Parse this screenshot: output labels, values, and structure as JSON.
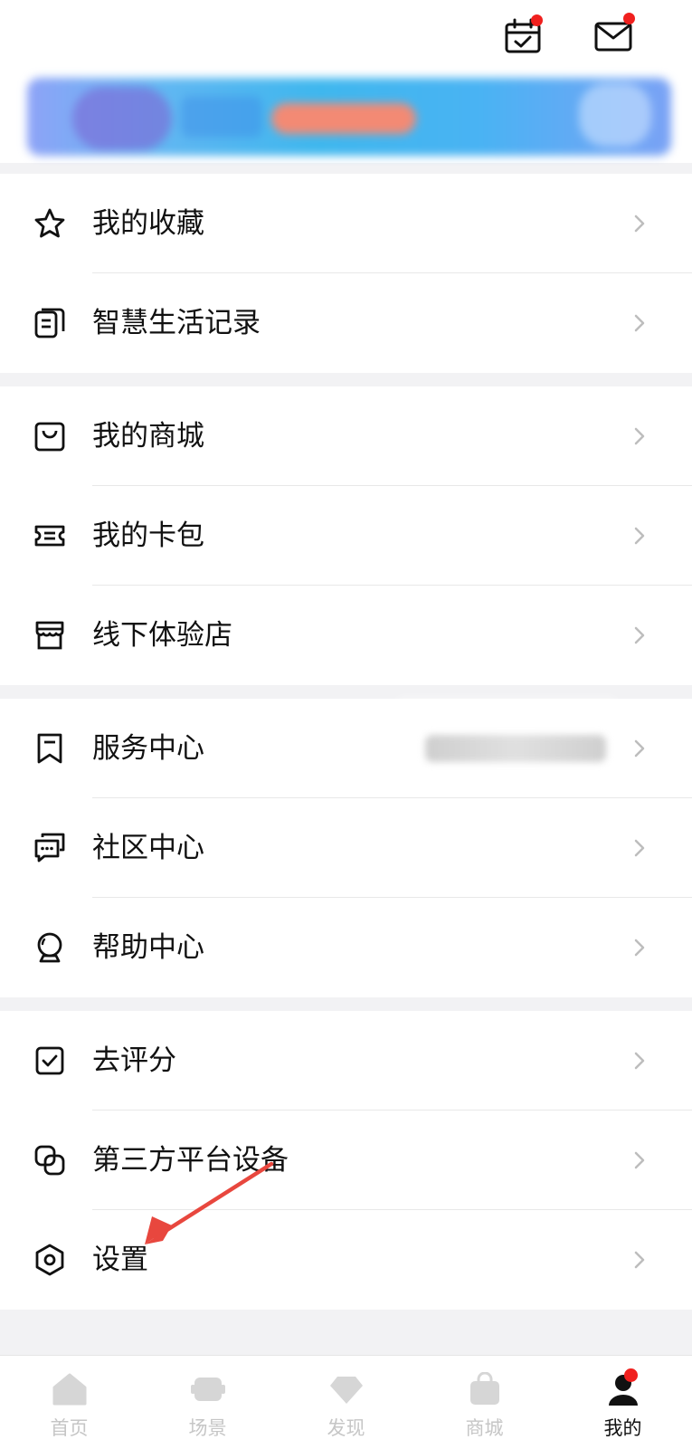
{
  "menu": {
    "group1": [
      {
        "label": "我的收藏",
        "icon": "star-icon"
      },
      {
        "label": "智慧生活记录",
        "icon": "document-icon"
      }
    ],
    "group2": [
      {
        "label": "我的商城",
        "icon": "shopping-bag-icon"
      },
      {
        "label": "我的卡包",
        "icon": "ticket-icon"
      },
      {
        "label": "线下体验店",
        "icon": "store-icon"
      }
    ],
    "group3": [
      {
        "label": "服务中心",
        "icon": "bookmark-icon"
      },
      {
        "label": "社区中心",
        "icon": "chat-bubbles-icon"
      },
      {
        "label": "帮助中心",
        "icon": "help-bulb-icon"
      }
    ],
    "group4": [
      {
        "label": "去评分",
        "icon": "checkbox-icon"
      },
      {
        "label": "第三方平台设备",
        "icon": "link-devices-icon"
      },
      {
        "label": "设置",
        "icon": "gear-hexagon-icon"
      }
    ]
  },
  "tabbar": [
    {
      "label": "首页",
      "icon": "home-icon",
      "active": false
    },
    {
      "label": "场景",
      "icon": "scene-icon",
      "active": false
    },
    {
      "label": "发现",
      "icon": "diamond-icon",
      "active": false
    },
    {
      "label": "商城",
      "icon": "bag-icon",
      "active": false
    },
    {
      "label": "我的",
      "icon": "profile-icon",
      "active": true
    }
  ],
  "colors": {
    "badge": "#f0201e",
    "annotation_arrow": "#e8473e",
    "inactive_tab": "#c6c6c6"
  }
}
